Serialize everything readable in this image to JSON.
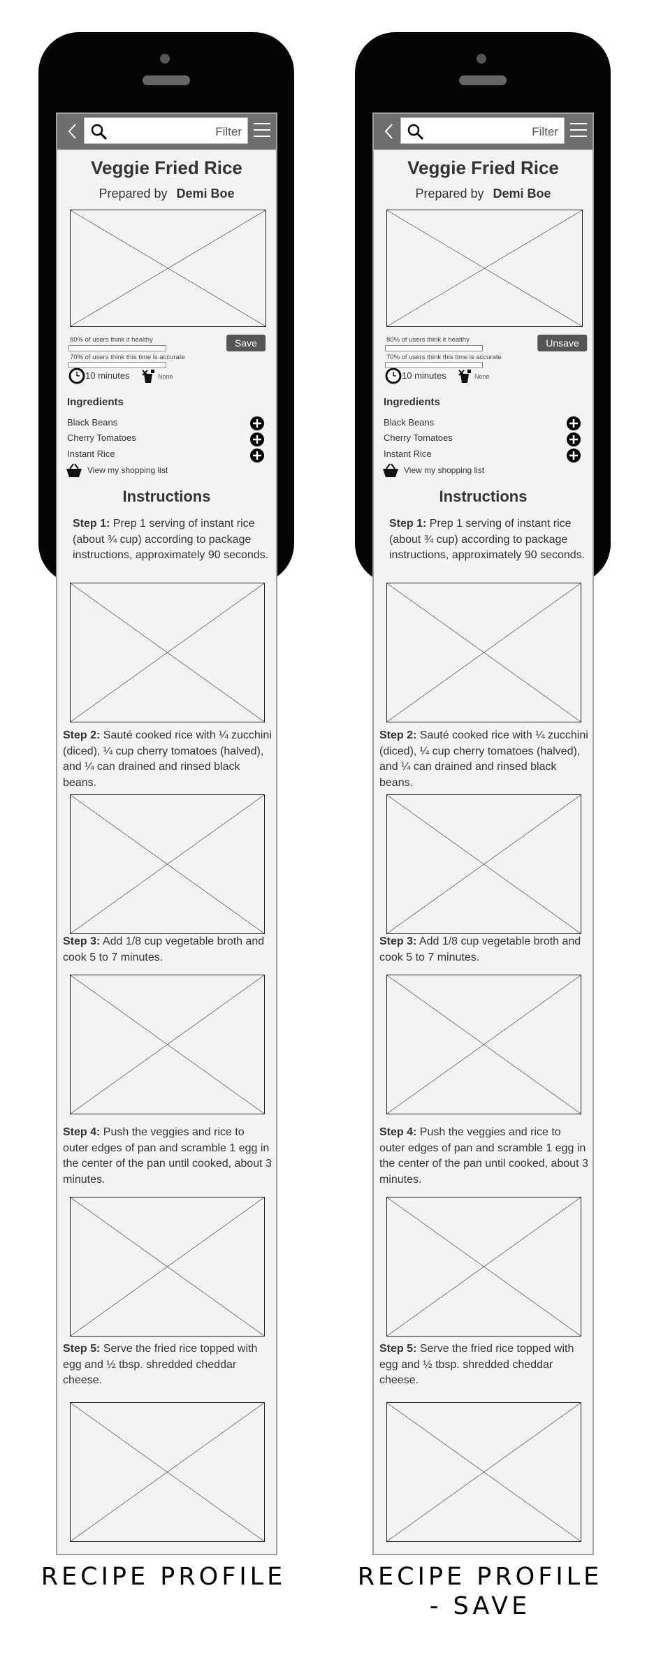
{
  "screens": [
    {
      "search": {
        "filter_label": "Filter"
      },
      "recipe": {
        "title": "Veggie Fried Rice",
        "prepared_by_label": "Prepared by",
        "chef": "Demi Boe",
        "healthy_text": "80% of users think it healthy",
        "healthy_pct": 80,
        "accurate_text": "70% of users think this time is accurate",
        "accurate_pct": 70,
        "save_label": "Save",
        "time": "10 minutes",
        "allergen": "None"
      },
      "ingredients": {
        "heading": "Ingredients",
        "items": [
          "Black Beans",
          "Cherry Tomatoes",
          "Instant Rice"
        ],
        "shopping_link": "View my shopping list"
      },
      "instructions": {
        "heading": "Instructions",
        "steps": [
          {
            "label": "Step 1:",
            "text": "Prep 1 serving of instant rice (about ¾ cup) according to package instructions, approximately 90 seconds."
          },
          {
            "label": "Step 2:",
            "text": "Sauté cooked rice with ¼ zucchini (diced), ¼ cup cherry tomatoes (halved), and ¼ can drained and rinsed black beans."
          },
          {
            "label": "Step 3:",
            "text": "Add 1/8 cup vegetable broth and cook 5 to 7 minutes."
          },
          {
            "label": "Step 4:",
            "text": "Push the veggies and rice to outer edges of pan and scramble 1 egg in the center of the pan until cooked, about 3 minutes."
          },
          {
            "label": "Step 5:",
            "text": "Serve the fried rice topped with egg and ½ tbsp. shredded cheddar cheese."
          }
        ]
      },
      "caption": "RECIPE PROFILE"
    },
    {
      "search": {
        "filter_label": "Filter"
      },
      "recipe": {
        "title": "Veggie Fried Rice",
        "prepared_by_label": "Prepared by",
        "chef": "Demi Boe",
        "healthy_text": "80% of users think it healthy",
        "healthy_pct": 80,
        "accurate_text": "70% of users think this time is accurate",
        "accurate_pct": 70,
        "save_label": "Unsave",
        "time": "10 minutes",
        "allergen": "None"
      },
      "ingredients": {
        "heading": "Ingredients",
        "items": [
          "Black Beans",
          "Cherry Tomatoes",
          "Instant Rice"
        ],
        "shopping_link": "View my shopping list"
      },
      "instructions": {
        "heading": "Instructions",
        "steps": [
          {
            "label": "Step 1:",
            "text": "Prep 1 serving of instant rice (about ¾ cup) according to package instructions, approximately 90 seconds."
          },
          {
            "label": "Step 2:",
            "text": "Sauté cooked rice with ¼ zucchini (diced), ¼ cup cherry tomatoes (halved), and ¼ can drained and rinsed black beans."
          },
          {
            "label": "Step 3:",
            "text": "Add 1/8 cup vegetable broth and cook 5 to 7 minutes."
          },
          {
            "label": "Step 4:",
            "text": "Push the veggies and rice to outer edges of pan and scramble 1 egg in the center of the pan until cooked, about 3 minutes."
          },
          {
            "label": "Step 5:",
            "text": "Serve the fried rice topped with egg and ½ tbsp. shredded cheddar cheese."
          }
        ]
      },
      "caption": "RECIPE PROFILE - SAVE"
    }
  ]
}
